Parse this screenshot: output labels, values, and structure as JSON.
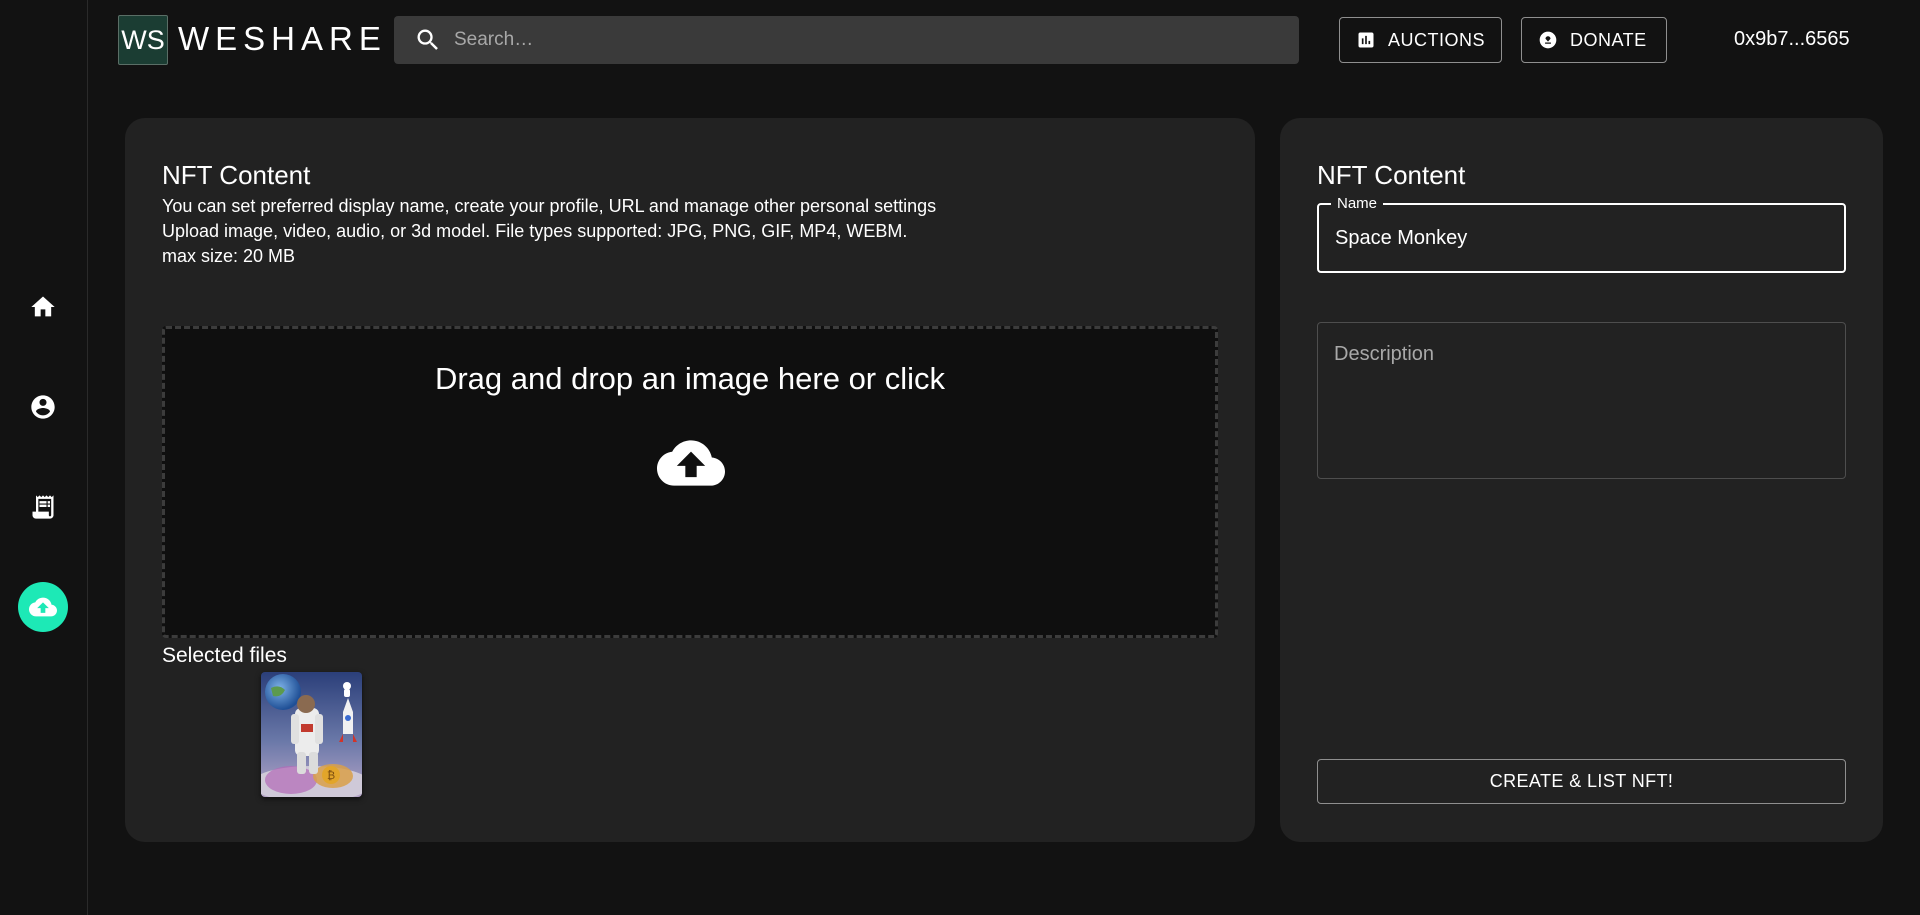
{
  "header": {
    "logo_text": "WS",
    "brand": "WESHARE",
    "search_placeholder": "Search…",
    "auctions_label": "AUCTIONS",
    "donate_label": "DONATE",
    "wallet_address": "0x9b7...6565"
  },
  "sidebar": {
    "items": [
      {
        "icon": "home-icon"
      },
      {
        "icon": "account-circle-icon"
      },
      {
        "icon": "receipt-icon"
      },
      {
        "icon": "cloud-upload-icon",
        "active": true
      }
    ],
    "accent_color": "#1de9b6"
  },
  "upload_card": {
    "title": "NFT Content",
    "description_lines": [
      "You can set preferred display name, create your profile, URL and manage other personal settings",
      "Upload image, video, audio, or 3d model. File types supported: JPG, PNG, GIF, MP4, WEBM.",
      "max size: 20 MB"
    ],
    "dropzone_text": "Drag and drop an image here or click",
    "selected_files_label": "Selected files"
  },
  "form_card": {
    "title": "NFT Content",
    "name_label": "Name",
    "name_value": "Space Monkey",
    "description_placeholder": "Description",
    "submit_label": "CREATE & LIST NFT!"
  }
}
